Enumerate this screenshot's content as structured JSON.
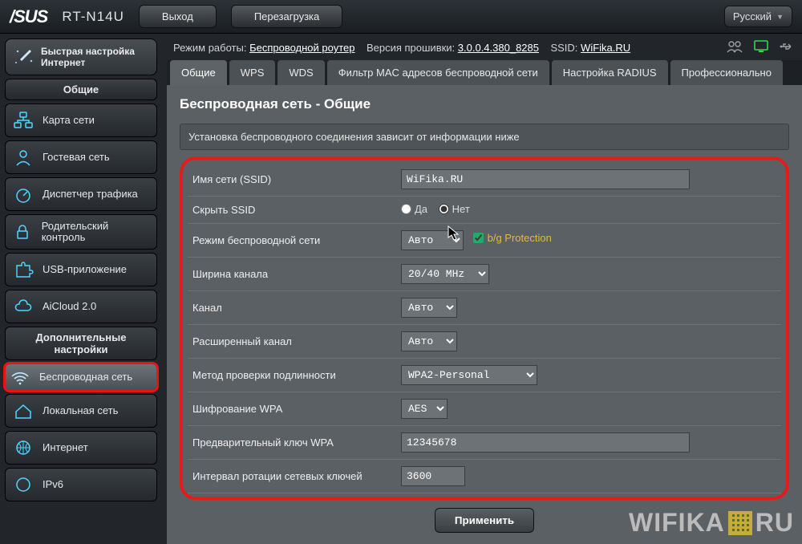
{
  "header": {
    "brand": "/SUS",
    "model": "RT-N14U",
    "exit": "Выход",
    "reboot": "Перезагрузка",
    "language": "Русский"
  },
  "info": {
    "mode_label": "Режим работы:",
    "mode_value": "Беспроводной роутер",
    "fw_label": "Версия прошивки:",
    "fw_value": "3.0.0.4.380_8285",
    "ssid_label": "SSID:",
    "ssid_value": "WiFika.RU"
  },
  "quick": "Быстрая настройка Интернет",
  "groups": {
    "general": "Общие",
    "advanced": "Дополнительные настройки"
  },
  "nav": [
    {
      "id": "map",
      "label": "Карта сети"
    },
    {
      "id": "guest",
      "label": "Гостевая сеть"
    },
    {
      "id": "traffic",
      "label": "Диспетчер трафика"
    },
    {
      "id": "parental",
      "label": "Родительский контроль"
    },
    {
      "id": "usb",
      "label": "USB-приложение"
    },
    {
      "id": "aicloud",
      "label": "AiCloud 2.0"
    }
  ],
  "nav2": [
    {
      "id": "wireless",
      "label": "Беспроводная сеть",
      "selected": true
    },
    {
      "id": "lan",
      "label": "Локальная сеть"
    },
    {
      "id": "wan",
      "label": "Интернет"
    },
    {
      "id": "ipv6",
      "label": "IPv6"
    }
  ],
  "tabs": [
    "Общие",
    "WPS",
    "WDS",
    "Фильтр MAC адресов беспроводной сети",
    "Настройка RADIUS",
    "Профессионально"
  ],
  "active_tab": 0,
  "page": {
    "title": "Беспроводная сеть - Общие",
    "desc": "Установка беспроводного соединения зависит от информации ниже",
    "apply": "Применить"
  },
  "form": {
    "ssid_label": "Имя сети (SSID)",
    "ssid_value": "WiFika.RU",
    "hide_label": "Скрыть SSID",
    "hide_yes": "Да",
    "hide_no": "Нет",
    "hide_value": "no",
    "mode_label": "Режим беспроводной сети",
    "mode_value": "Авто",
    "bg_label": "b/g Protection",
    "bg_checked": true,
    "width_label": "Ширина канала",
    "width_value": "20/40 MHz",
    "channel_label": "Канал",
    "channel_value": "Авто",
    "ext_label": "Расширенный канал",
    "ext_value": "Авто",
    "auth_label": "Метод проверки подлинности",
    "auth_value": "WPA2-Personal",
    "enc_label": "Шифрование WPA",
    "enc_value": "AES",
    "psk_label": "Предварительный ключ WPA",
    "psk_value": "12345678",
    "rekey_label": "Интервал ротации сетевых ключей",
    "rekey_value": "3600"
  },
  "watermark": {
    "a": "WIFIKA",
    "b": "RU"
  }
}
